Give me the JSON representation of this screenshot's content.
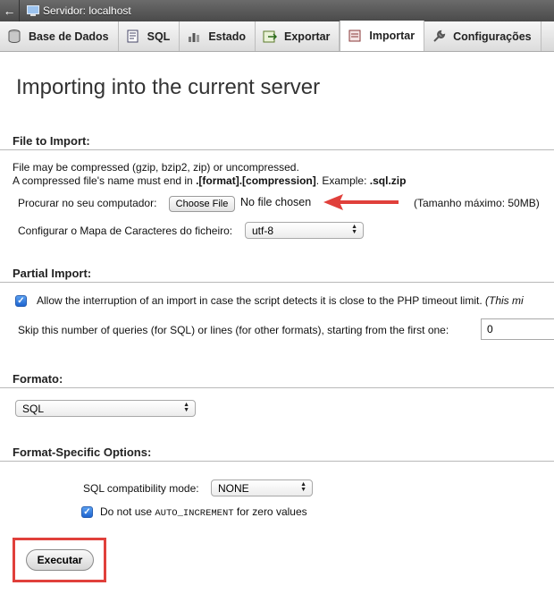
{
  "topbar": {
    "back_glyph": "←",
    "server_label": "Servidor: localhost"
  },
  "tabs": [
    {
      "label": "Base de Dados",
      "icon": "database-icon"
    },
    {
      "label": "SQL",
      "icon": "sql-icon"
    },
    {
      "label": "Estado",
      "icon": "status-icon"
    },
    {
      "label": "Exportar",
      "icon": "export-icon"
    },
    {
      "label": "Importar",
      "icon": "import-icon",
      "active": true
    },
    {
      "label": "Configurações",
      "icon": "wrench-icon"
    }
  ],
  "page_title": "Importing into the current server",
  "file_section": {
    "heading": "File to Import:",
    "line1": "File may be compressed (gzip, bzip2, zip) or uncompressed.",
    "line2_prefix": "A compressed file's name must end in ",
    "line2_format": ".[format].[compression]",
    "line2_mid": ". Example: ",
    "line2_example": ".sql.zip",
    "browse_label": "Procurar no seu computador:",
    "choose_file": "Choose File",
    "no_file": "No file chosen",
    "max_size": "(Tamanho máximo: 50MB)",
    "charset_label": "Configurar o Mapa de Caracteres do ficheiro:",
    "charset_value": "utf-8"
  },
  "partial_section": {
    "heading": "Partial Import:",
    "allow_interrupt": "Allow the interruption of an import in case the script detects it is close to the PHP timeout limit.",
    "allow_interrupt_note": "(This mi",
    "allow_checked": true,
    "skip_label": "Skip this number of queries (for SQL) or lines (for other formats), starting from the first one:",
    "skip_value": "0"
  },
  "format_section": {
    "heading": "Formato:",
    "format_value": "SQL"
  },
  "options_section": {
    "heading": "Format-Specific Options:",
    "compat_label": "SQL compatibility mode:",
    "compat_value": "NONE",
    "autoinc_prefix": "Do not use ",
    "autoinc_code": "AUTO_INCREMENT",
    "autoinc_suffix": " for zero values",
    "autoinc_checked": true
  },
  "execute_label": "Executar",
  "colors": {
    "annotation_red": "#e0403b",
    "checkbox_blue": "#1d64d0"
  }
}
